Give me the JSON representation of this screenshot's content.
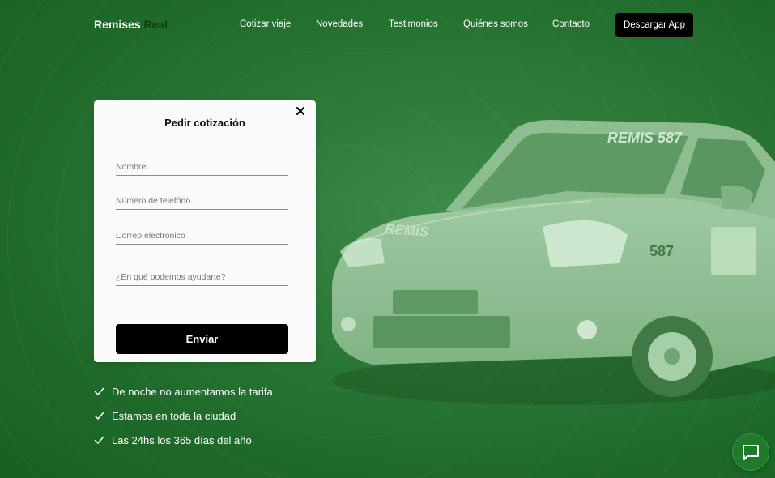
{
  "header": {
    "logo_primary": "Remises",
    "logo_accent": "Real",
    "nav": [
      "Cotizar viaje",
      "Novedades",
      "Testimonios",
      "Quiénes somos",
      "Contacto"
    ],
    "cta_label": "Descargar App"
  },
  "form": {
    "title": "Pedir cotización",
    "name_placeholder": "Nombre",
    "phone_placeholder": "Número de telefóno",
    "email_placeholder": "Correo electrónico",
    "message_placeholder": "¿En qué podemos ayudarte?",
    "submit_label": "Enviar"
  },
  "features": [
    "De noche no aumentamos la tarifa",
    "Estamos en toda la ciudad",
    "Las 24hs los 365 días del año"
  ],
  "car": {
    "roof_text": "REMIS 587",
    "hood_text": "REMIS",
    "door_number": "587"
  },
  "colors": {
    "background": "#2d7a38",
    "logo_accent": "#0f3d14",
    "button": "#000000"
  }
}
